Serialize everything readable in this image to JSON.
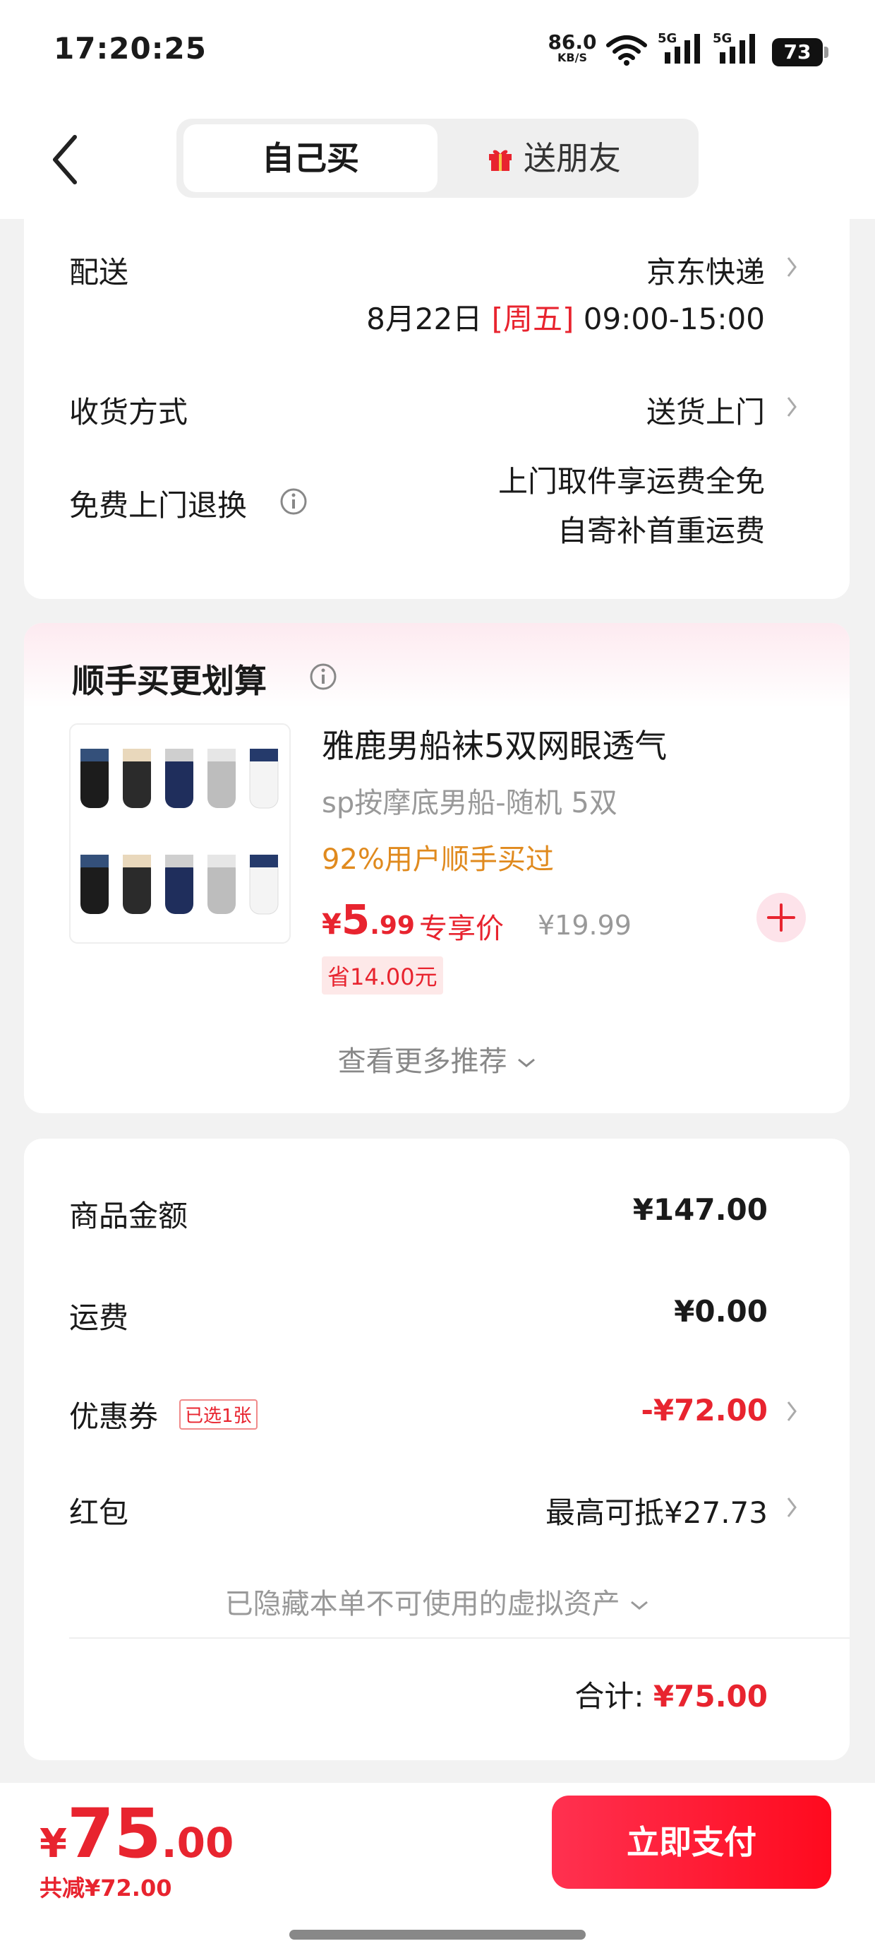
{
  "status_bar": {
    "time": "17:20:25",
    "net_speed": "86.0",
    "net_unit": "KB/S",
    "signal_1": "5G",
    "signal_2": "5G",
    "battery": "73"
  },
  "header": {
    "tab_self": "自己买",
    "tab_gift": "送朋友"
  },
  "delivery": {
    "label": "配送",
    "carrier": "京东快递",
    "date": "8月22日",
    "weekday": "[周五]",
    "time_window": "09:00-15:00",
    "receive_label": "收货方式",
    "receive_value": "送货上门",
    "return_label": "免费上门退换",
    "return_line1": "上门取件享运费全免",
    "return_line2": "自寄补首重运费"
  },
  "addon": {
    "title": "顺手买更划算",
    "product_name": "雅鹿男船袜5双网眼透气",
    "product_spec": "sp按摩底男船-随机 5双",
    "percent_text": "92%用户顺手买过",
    "price_currency": "¥",
    "price_int": "5",
    "price_dec": ".99",
    "price_tag": "专享价",
    "original_price": "¥19.99",
    "save_text": "省14.00元",
    "more_text": "查看更多推荐"
  },
  "summary": {
    "goods_label": "商品金额",
    "goods_value": "¥147.00",
    "shipping_label": "运费",
    "shipping_value": "¥0.00",
    "coupon_label": "优惠券",
    "coupon_badge": "已选1张",
    "coupon_value": "-¥72.00",
    "redpacket_label": "红包",
    "redpacket_value": "最高可抵¥27.73",
    "hidden_note": "已隐藏本单不可使用的虚拟资产",
    "total_label": "合计:",
    "total_value": "¥75.00"
  },
  "bottom_bar": {
    "currency": "¥",
    "total_int": "75",
    "total_dec": ".00",
    "saved_text": "共减¥72.00",
    "pay_label": "立即支付"
  },
  "colors": {
    "accent_red": "#e8242f",
    "orange": "#e08a1e",
    "background": "#f2f2f2"
  },
  "icons": [
    "back-arrow-icon",
    "gift-icon",
    "chevron-right-icon",
    "info-icon",
    "plus-icon",
    "chevron-down-icon",
    "wifi-icon",
    "signal-icon",
    "battery-icon"
  ]
}
